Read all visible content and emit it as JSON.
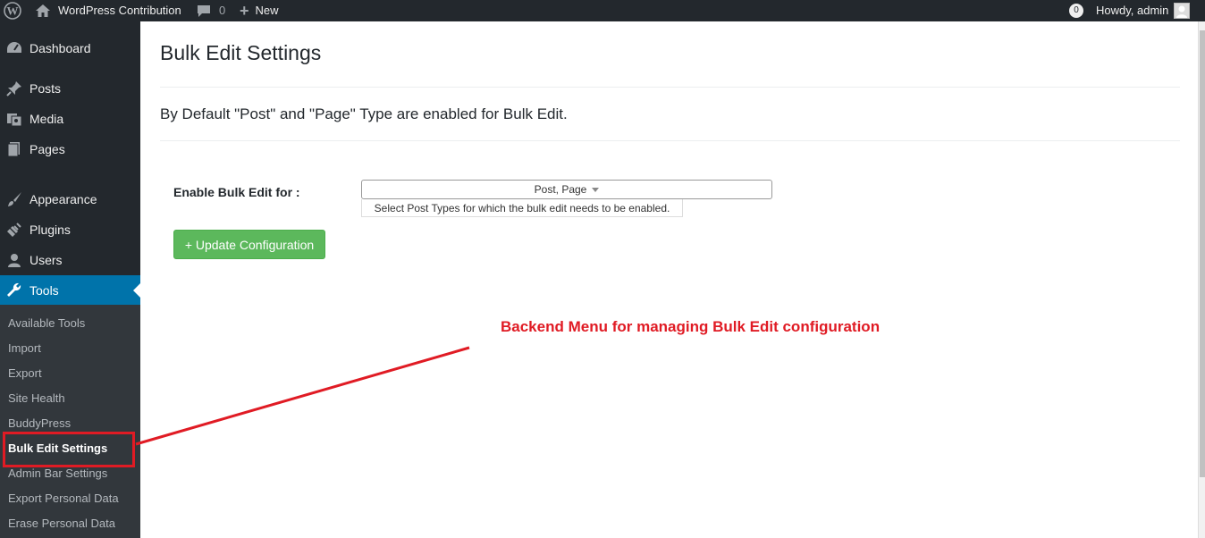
{
  "adminbar": {
    "site_name": "WordPress Contribution",
    "comments_count": "0",
    "new_label": "New",
    "notifications_count": "0",
    "howdy": "Howdy, admin"
  },
  "sidebar": {
    "items": [
      {
        "label": "Dashboard",
        "icon": "dashboard-icon"
      },
      {
        "label": "Posts",
        "icon": "pin-icon"
      },
      {
        "label": "Media",
        "icon": "media-icon"
      },
      {
        "label": "Pages",
        "icon": "pages-icon"
      },
      {
        "label": "Appearance",
        "icon": "brush-icon"
      },
      {
        "label": "Plugins",
        "icon": "plugin-icon"
      },
      {
        "label": "Users",
        "icon": "user-icon"
      },
      {
        "label": "Tools",
        "icon": "wrench-icon"
      }
    ],
    "submenu": [
      "Available Tools",
      "Import",
      "Export",
      "Site Health",
      "BuddyPress",
      "Bulk Edit Settings",
      "Admin Bar Settings",
      "Export Personal Data",
      "Erase Personal Data"
    ]
  },
  "main": {
    "title": "Bulk Edit Settings",
    "description": "By Default \"Post\" and \"Page\" Type are enabled for Bulk Edit.",
    "field_label": "Enable Bulk Edit for :",
    "select_value": "Post, Page",
    "help_text": "Select Post Types for which the bulk edit needs to be enabled.",
    "button_label": "+ Update Configuration"
  },
  "annotation": {
    "text": "Backend Menu for managing Bulk Edit configuration",
    "color": "#e01b24"
  },
  "colors": {
    "adminbar_bg": "#23282d",
    "menu_active": "#0073aa",
    "submenu_bg": "#32373c",
    "button_green": "#5cb85c"
  }
}
